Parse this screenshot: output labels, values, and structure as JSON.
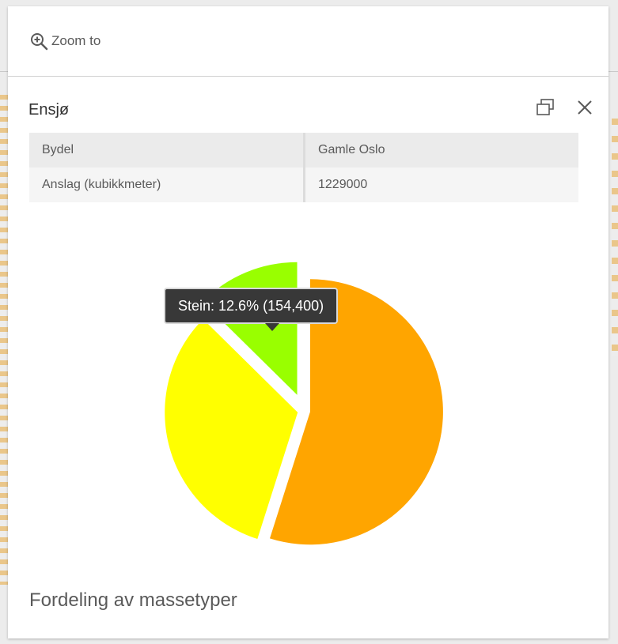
{
  "action_bar": {
    "zoom_label": "Zoom to"
  },
  "popup": {
    "title": "Ensjø"
  },
  "attributes": [
    {
      "key": "Bydel",
      "value": "Gamle Oslo"
    },
    {
      "key": "Anslag (kubikkmeter)",
      "value": "1229000"
    }
  ],
  "tooltip": {
    "text": "Stein: 12.6% (154,400)"
  },
  "chart_data": {
    "type": "pie",
    "title": "Fordeling av massetyper",
    "slices": [
      {
        "value": 54.9,
        "color": "#FFA500",
        "exploded": false
      },
      {
        "value": 32.5,
        "color": "#FFFF00",
        "exploded": false
      },
      {
        "name": "Stein",
        "value": 12.6,
        "color": "#99FF00",
        "exploded": true
      }
    ]
  },
  "colors": {
    "title": "#323232",
    "text": "#5a5a5a",
    "tooltip_bg": "#383838"
  },
  "icons": {
    "zoom": "zoom-in-icon",
    "dock": "dock-icon",
    "close": "close-icon"
  }
}
